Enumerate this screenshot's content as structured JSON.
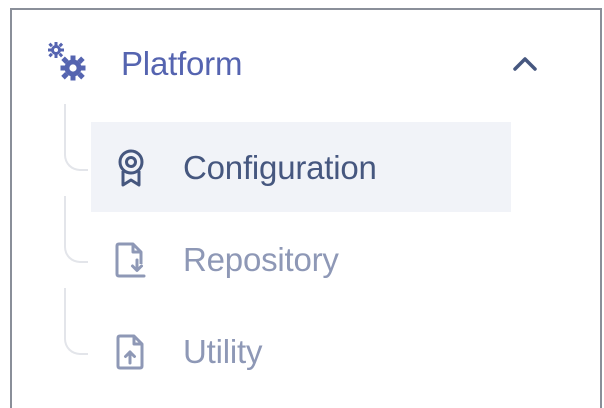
{
  "nav": {
    "section": {
      "label": "Platform",
      "icon": "gears-icon",
      "expanded": true,
      "toggle_icon": "chevron-up-icon"
    },
    "items": [
      {
        "label": "Configuration",
        "icon": "award-badge-icon",
        "active": true
      },
      {
        "label": "Repository",
        "icon": "file-download-icon",
        "active": false
      },
      {
        "label": "Utility",
        "icon": "file-upload-icon",
        "active": false
      }
    ]
  },
  "colors": {
    "accent": "#5564b0",
    "active_text": "#46577f",
    "muted_text": "#8e98b6",
    "active_bg": "#f1f3f8",
    "tree_line": "#e3e5ea",
    "frame_border": "#8a8f99"
  }
}
